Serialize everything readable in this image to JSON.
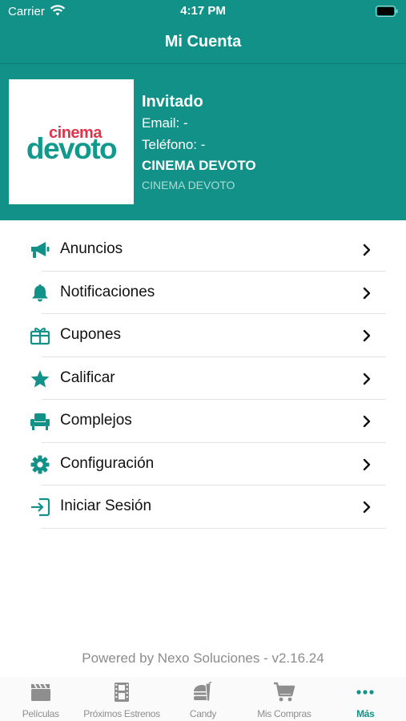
{
  "status_bar": {
    "carrier": "Carrier",
    "time": "4:17 PM"
  },
  "header": {
    "title": "Mi Cuenta"
  },
  "profile": {
    "logo_top": "cinema",
    "logo_bottom": "devoto",
    "name": "Invitado",
    "email": "Email: -",
    "phone": "Teléfono: -",
    "company": "CINEMA DEVOTO",
    "company_sub": "CINEMA DEVOTO"
  },
  "menu": [
    {
      "label": "Anuncios",
      "icon": "megaphone-icon"
    },
    {
      "label": "Notificaciones",
      "icon": "bell-icon"
    },
    {
      "label": "Cupones",
      "icon": "gift-icon"
    },
    {
      "label": "Calificar",
      "icon": "star-icon"
    },
    {
      "label": "Complejos",
      "icon": "armchair-icon"
    },
    {
      "label": "Configuración",
      "icon": "gear-icon"
    },
    {
      "label": "Iniciar Sesión",
      "icon": "sign-in-icon"
    }
  ],
  "footer": {
    "powered_by": "Powered by Nexo Soluciones - v2.16.24"
  },
  "tabs": [
    {
      "label": "Películas",
      "icon": "clapperboard-icon"
    },
    {
      "label": "Próximos Estrenos",
      "icon": "film-strip-icon"
    },
    {
      "label": "Candy",
      "icon": "food-icon"
    },
    {
      "label": "Mis Compras",
      "icon": "cart-icon"
    },
    {
      "label": "Más",
      "icon": "more-dots-icon",
      "active": true
    }
  ],
  "colors": {
    "accent": "#129188",
    "text": "#111111",
    "muted": "#8e8e8e",
    "logo_red": "#e0344a"
  }
}
